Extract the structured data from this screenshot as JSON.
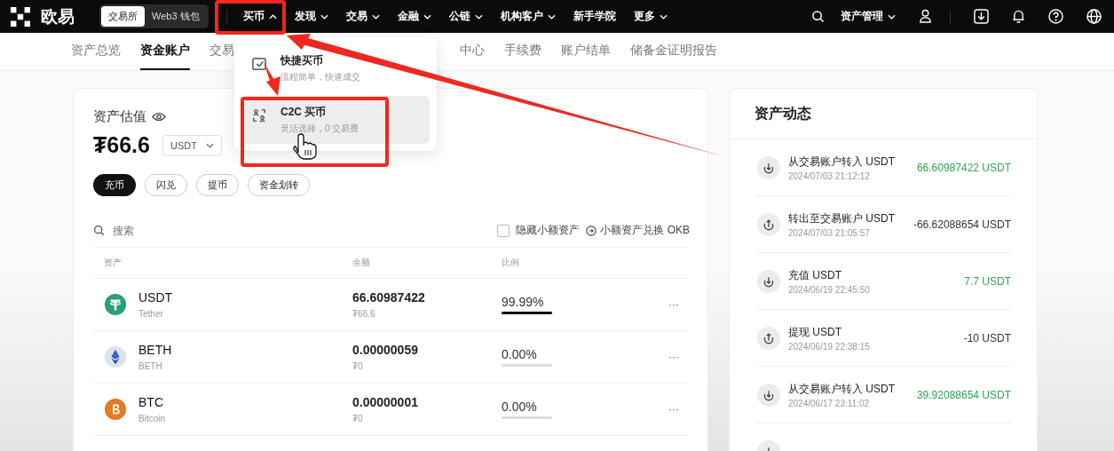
{
  "topbar": {
    "logo": "欧易",
    "modes": [
      {
        "label": "交易所",
        "selected": true
      },
      {
        "label": "Web3 钱包",
        "selected": false
      }
    ],
    "nav": [
      {
        "label": "买币",
        "has_menu": true,
        "expanded": true
      },
      {
        "label": "发现",
        "has_menu": true,
        "expanded": false
      },
      {
        "label": "交易",
        "has_menu": true,
        "expanded": false
      },
      {
        "label": "金融",
        "has_menu": true,
        "expanded": false
      },
      {
        "label": "公链",
        "has_menu": true,
        "expanded": false
      },
      {
        "label": "机构客户",
        "has_menu": true,
        "expanded": false
      },
      {
        "label": "新手学院",
        "has_menu": false
      },
      {
        "label": "更多",
        "has_menu": true,
        "expanded": false
      }
    ],
    "asset_menu": "资产管理"
  },
  "subnav": {
    "left": [
      {
        "label": "资产总览",
        "selected": false
      },
      {
        "label": "资金账户",
        "selected": true
      },
      {
        "label": "交易",
        "selected": false
      }
    ],
    "right": [
      {
        "label": "中心",
        "selected": false
      },
      {
        "label": "手续费",
        "selected": false
      },
      {
        "label": "账户结单",
        "selected": false
      },
      {
        "label": "储备金证明报告",
        "selected": false
      }
    ]
  },
  "dropdown": [
    {
      "title": "快捷买币",
      "desc": "流程简单，快速成交",
      "kind": "quick",
      "selected": false
    },
    {
      "title": "C2C 买币",
      "desc": "灵活选择，0 交易费",
      "kind": "c2c",
      "selected": true
    }
  ],
  "valuation": {
    "title": "资产估值",
    "amount": "₮66.6",
    "currency": "USDT"
  },
  "actions": [
    {
      "label": "充币",
      "primary": true
    },
    {
      "label": "闪兑",
      "primary": false
    },
    {
      "label": "提币",
      "primary": false
    },
    {
      "label": "资金划转",
      "primary": false
    }
  ],
  "search": {
    "placeholder": "搜索"
  },
  "hide_small": {
    "label": "隐藏小额资产",
    "checked": false
  },
  "convert_link": "小额资产兑换 OKB",
  "table": {
    "columns": [
      "资产",
      "余额",
      "比例"
    ],
    "rows": [
      {
        "symbol": "USDT",
        "name": "Tether",
        "kind": "usdt",
        "balance": "66.60987422",
        "cny": "₮66.6",
        "ratio": "99.99%",
        "level": 0.9999,
        "more": "···"
      },
      {
        "symbol": "BETH",
        "name": "BETH",
        "kind": "eth",
        "balance": "0.00000059",
        "cny": "₮0",
        "ratio": "0.00%",
        "level": 0,
        "more": "···"
      },
      {
        "symbol": "BTC",
        "name": "Bitcoin",
        "kind": "btc",
        "balance": "0.00000001",
        "cny": "₮0",
        "ratio": "0.00%",
        "level": 0,
        "more": "···"
      }
    ]
  },
  "activity": {
    "title": "资产动态",
    "items": [
      {
        "title": "从交易账户转入 USDT",
        "time": "2024/07/03 21:12:12",
        "amount": "66.60987422 USDT",
        "kind": "in"
      },
      {
        "title": "转出至交易账户 USDT",
        "time": "2024/07/03 21:05:57",
        "amount": "-66.62088654 USDT",
        "kind": "out"
      },
      {
        "title": "充值 USDT",
        "time": "2024/06/19 22:45:50",
        "amount": "7.7 USDT",
        "kind": "in"
      },
      {
        "title": "提现 USDT",
        "time": "2024/06/19 22:38:15",
        "amount": "-10 USDT",
        "kind": "out"
      },
      {
        "title": "从交易账户转入 USDT",
        "time": "2024/06/17 23:11:02",
        "amount": "39.92088654 USDT",
        "kind": "in"
      },
      {
        "kind": "in"
      }
    ]
  }
}
